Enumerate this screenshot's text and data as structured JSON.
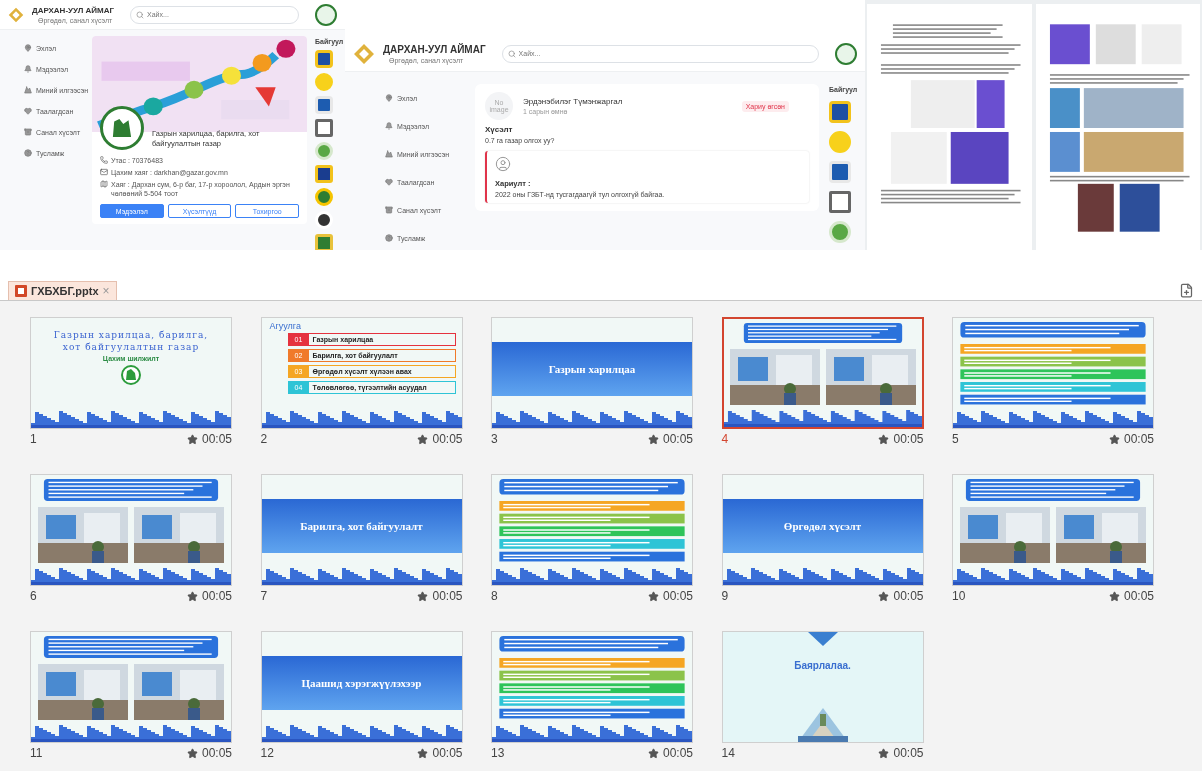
{
  "screenshots": [
    {
      "kind": "org-profile",
      "brand": {
        "title": "ДАРХАН-УУЛ АЙМАГ",
        "subtitle": "Өргөдөл, санал хүсэлт"
      },
      "search": {
        "placeholder": "Хайх..."
      },
      "nav": [
        "Эхлэл",
        "Мэдээлэл",
        "Миний илгээсэн",
        "Таалагдсан",
        "Санал хүсэлт",
        "Тусламж"
      ],
      "org": {
        "name": "Газрын харилцаа, барилга, хот байгуулалтын газар",
        "contacts": [
          {
            "kind": "phone",
            "text": "Утас : 70376483"
          },
          {
            "kind": "email",
            "text": "Цахим хаяг : darkhan@gazar.gov.mn"
          },
          {
            "kind": "address",
            "text": "Хаяг : Дархан сум, 6-р баг, 17-р хороолол, Ардын эргэн чөлөөний 5-504 тоот"
          }
        ],
        "tabs": [
          {
            "label": "Мэдээлэл",
            "selected": true
          },
          {
            "label": "Хүсэлтүүд",
            "selected": false
          },
          {
            "label": "Тохиргоо",
            "selected": false
          }
        ]
      },
      "aside_title": "Байгуул"
    },
    {
      "kind": "request",
      "brand": {
        "title": "ДАРХАН-УУЛ АЙМАГ",
        "subtitle": "Өргөдөл, санал хүсэлт"
      },
      "search": {
        "placeholder": "Хайх..."
      },
      "nav": [
        "Эхлэл",
        "Мэдээлэл",
        "Миний илгээсэн",
        "Таалагдсан",
        "Санал хүсэлт",
        "Тусламж"
      ],
      "request": {
        "avatar": "No image",
        "author": "Эрдэнэбилэг Түмэнжаргал",
        "time": "1 сарын өмнө",
        "status": "Хариу өгсөн",
        "heading": "Хүсэлт",
        "text": "0.7 га газар олгох уу?",
        "answer_label": "Хариулт :",
        "answer": "2022 оны ГЗБТ-нд тусгагдаагүй тул олгохгүй байгаа."
      },
      "aside_title": "Байгуул"
    }
  ],
  "documents": [
    {
      "kind": "text"
    },
    {
      "kind": "photos"
    }
  ],
  "file_tab": {
    "title": "ГХБХБГ.pptx",
    "close": "×"
  },
  "slides": [
    {
      "number": "1",
      "kind": "cover",
      "title": "Газрын харилцаа, барилга, хот байгуулалтын газар",
      "subtitle": "Цахим шилжилт",
      "duration": "00:05",
      "selected": false
    },
    {
      "number": "2",
      "kind": "agenda",
      "title": "Агуулга",
      "items": [
        {
          "num": "01",
          "label": "Газрын харилцаа",
          "color": "#e5323e"
        },
        {
          "num": "02",
          "label": "Барилга, хот байгуулалт",
          "color": "#f07a2a"
        },
        {
          "num": "03",
          "label": "Өргөдөл хүсэлт хүлээн авах",
          "color": "#f5a623"
        },
        {
          "num": "04",
          "label": "Төлөвлөгөө, түгээлтийн асуудал",
          "color": "#2ec4d6"
        }
      ],
      "duration": "00:05",
      "selected": false
    },
    {
      "number": "3",
      "kind": "title",
      "title": "Газрын харилцаа",
      "duration": "00:05",
      "selected": false
    },
    {
      "number": "4",
      "kind": "gallery",
      "duration": "00:05",
      "selected": true
    },
    {
      "number": "5",
      "kind": "bars",
      "duration": "00:05",
      "selected": false
    },
    {
      "number": "6",
      "kind": "gallery",
      "duration": "00:05",
      "selected": false
    },
    {
      "number": "7",
      "kind": "title",
      "title": "Барилга, хот байгуулалт",
      "duration": "00:05",
      "selected": false
    },
    {
      "number": "8",
      "kind": "bars",
      "duration": "00:05",
      "selected": false
    },
    {
      "number": "9",
      "kind": "title",
      "title": "Өргөдөл хүсэлт",
      "duration": "00:05",
      "selected": false
    },
    {
      "number": "10",
      "kind": "gallery",
      "duration": "00:05",
      "selected": false
    },
    {
      "number": "11",
      "kind": "gallery",
      "duration": "00:05",
      "selected": false
    },
    {
      "number": "12",
      "kind": "title",
      "title": "Цаашид хэрэгжүүлэхээр",
      "duration": "00:05",
      "selected": false
    },
    {
      "number": "13",
      "kind": "bars",
      "duration": "00:05",
      "selected": false
    },
    {
      "number": "14",
      "kind": "thanks",
      "title": "Баярлалаа.",
      "duration": "00:05",
      "selected": false
    }
  ]
}
